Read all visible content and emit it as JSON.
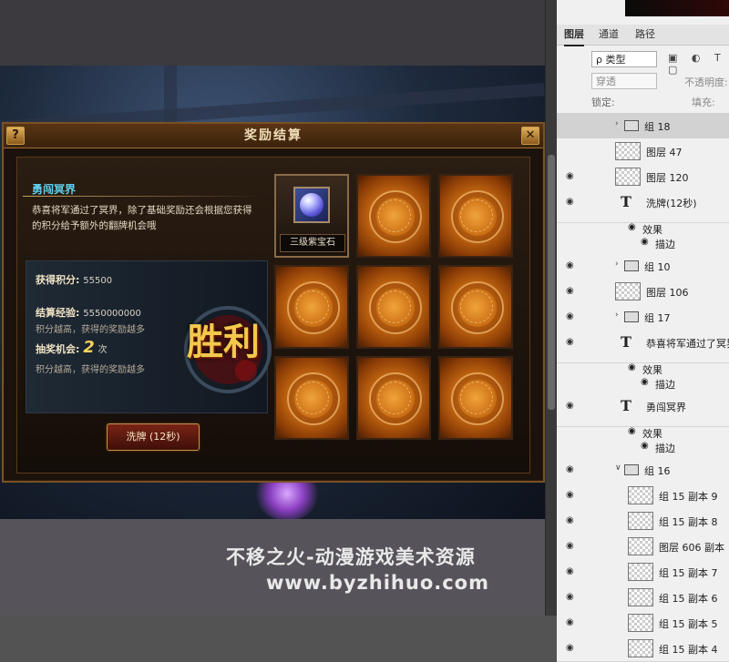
{
  "dialog": {
    "title": "奖励结算",
    "help_label": "?",
    "close_label": "✕",
    "info_title": "勇闯冥界",
    "info_desc": "恭喜将军通过了冥界，除了基础奖励还会根据您获得的积分给予额外的翻牌机会哦",
    "score_label": "获得积分:",
    "score_value": "55500",
    "exp_label": "结算经验:",
    "exp_value": "5550000000",
    "exp_note": "积分越高，获得的奖励越多",
    "chance_label": "抽奖机会:",
    "chance_value": "2",
    "chance_unit": "次",
    "chance_note": "积分越高，获得的奖励越多",
    "victory_text": "胜利",
    "shuffle_label": "洗牌 (12秒)",
    "reward_item_label": "三级紫宝石"
  },
  "ps": {
    "tabs": [
      "图层",
      "通道",
      "路径"
    ],
    "filter_label": "ρ 类型",
    "filter_icons": "▣ ◐ T ▢",
    "blend_mode": "穿透",
    "opacity_label": "不透明度:",
    "lock_label": "锁定:",
    "fill_label": "填充:",
    "layers": [
      {
        "name": "组 18",
        "type": "group"
      },
      {
        "name": "图层 47",
        "type": "layer"
      },
      {
        "name": "图层 120",
        "type": "layer"
      },
      {
        "name": "洗牌(12秒)",
        "type": "text",
        "effect": "效果",
        "effect_sub": "描边"
      },
      {
        "name": "组 10",
        "type": "group"
      },
      {
        "name": "图层 106",
        "type": "layer"
      },
      {
        "name": "组 17",
        "type": "group"
      },
      {
        "name": "恭喜将军通过了冥界",
        "type": "text",
        "effect": "效果",
        "effect_sub": "描边"
      },
      {
        "name": "勇闯冥界",
        "type": "text",
        "effect": "效果",
        "effect_sub": "描边"
      },
      {
        "name": "组 16",
        "type": "group-open"
      },
      {
        "name": "组 15 副本 9",
        "type": "sublayer"
      },
      {
        "name": "组 15 副本 8",
        "type": "sublayer"
      },
      {
        "name": "图层 606 副本",
        "type": "sublayer"
      },
      {
        "name": "组 15 副本 7",
        "type": "sublayer"
      },
      {
        "name": "组 15 副本 6",
        "type": "sublayer"
      },
      {
        "name": "组 15 副本 5",
        "type": "sublayer"
      },
      {
        "name": "组 15 副本 4",
        "type": "sublayer"
      }
    ]
  },
  "watermark": {
    "line1": "不移之火-动漫游戏美术资源",
    "line2": "www.byzhihuo.com"
  },
  "colors": {
    "accent_gold": "#c59a4a",
    "title_cyan": "#5fd2f0",
    "victory_gold": "#f3c94c"
  }
}
